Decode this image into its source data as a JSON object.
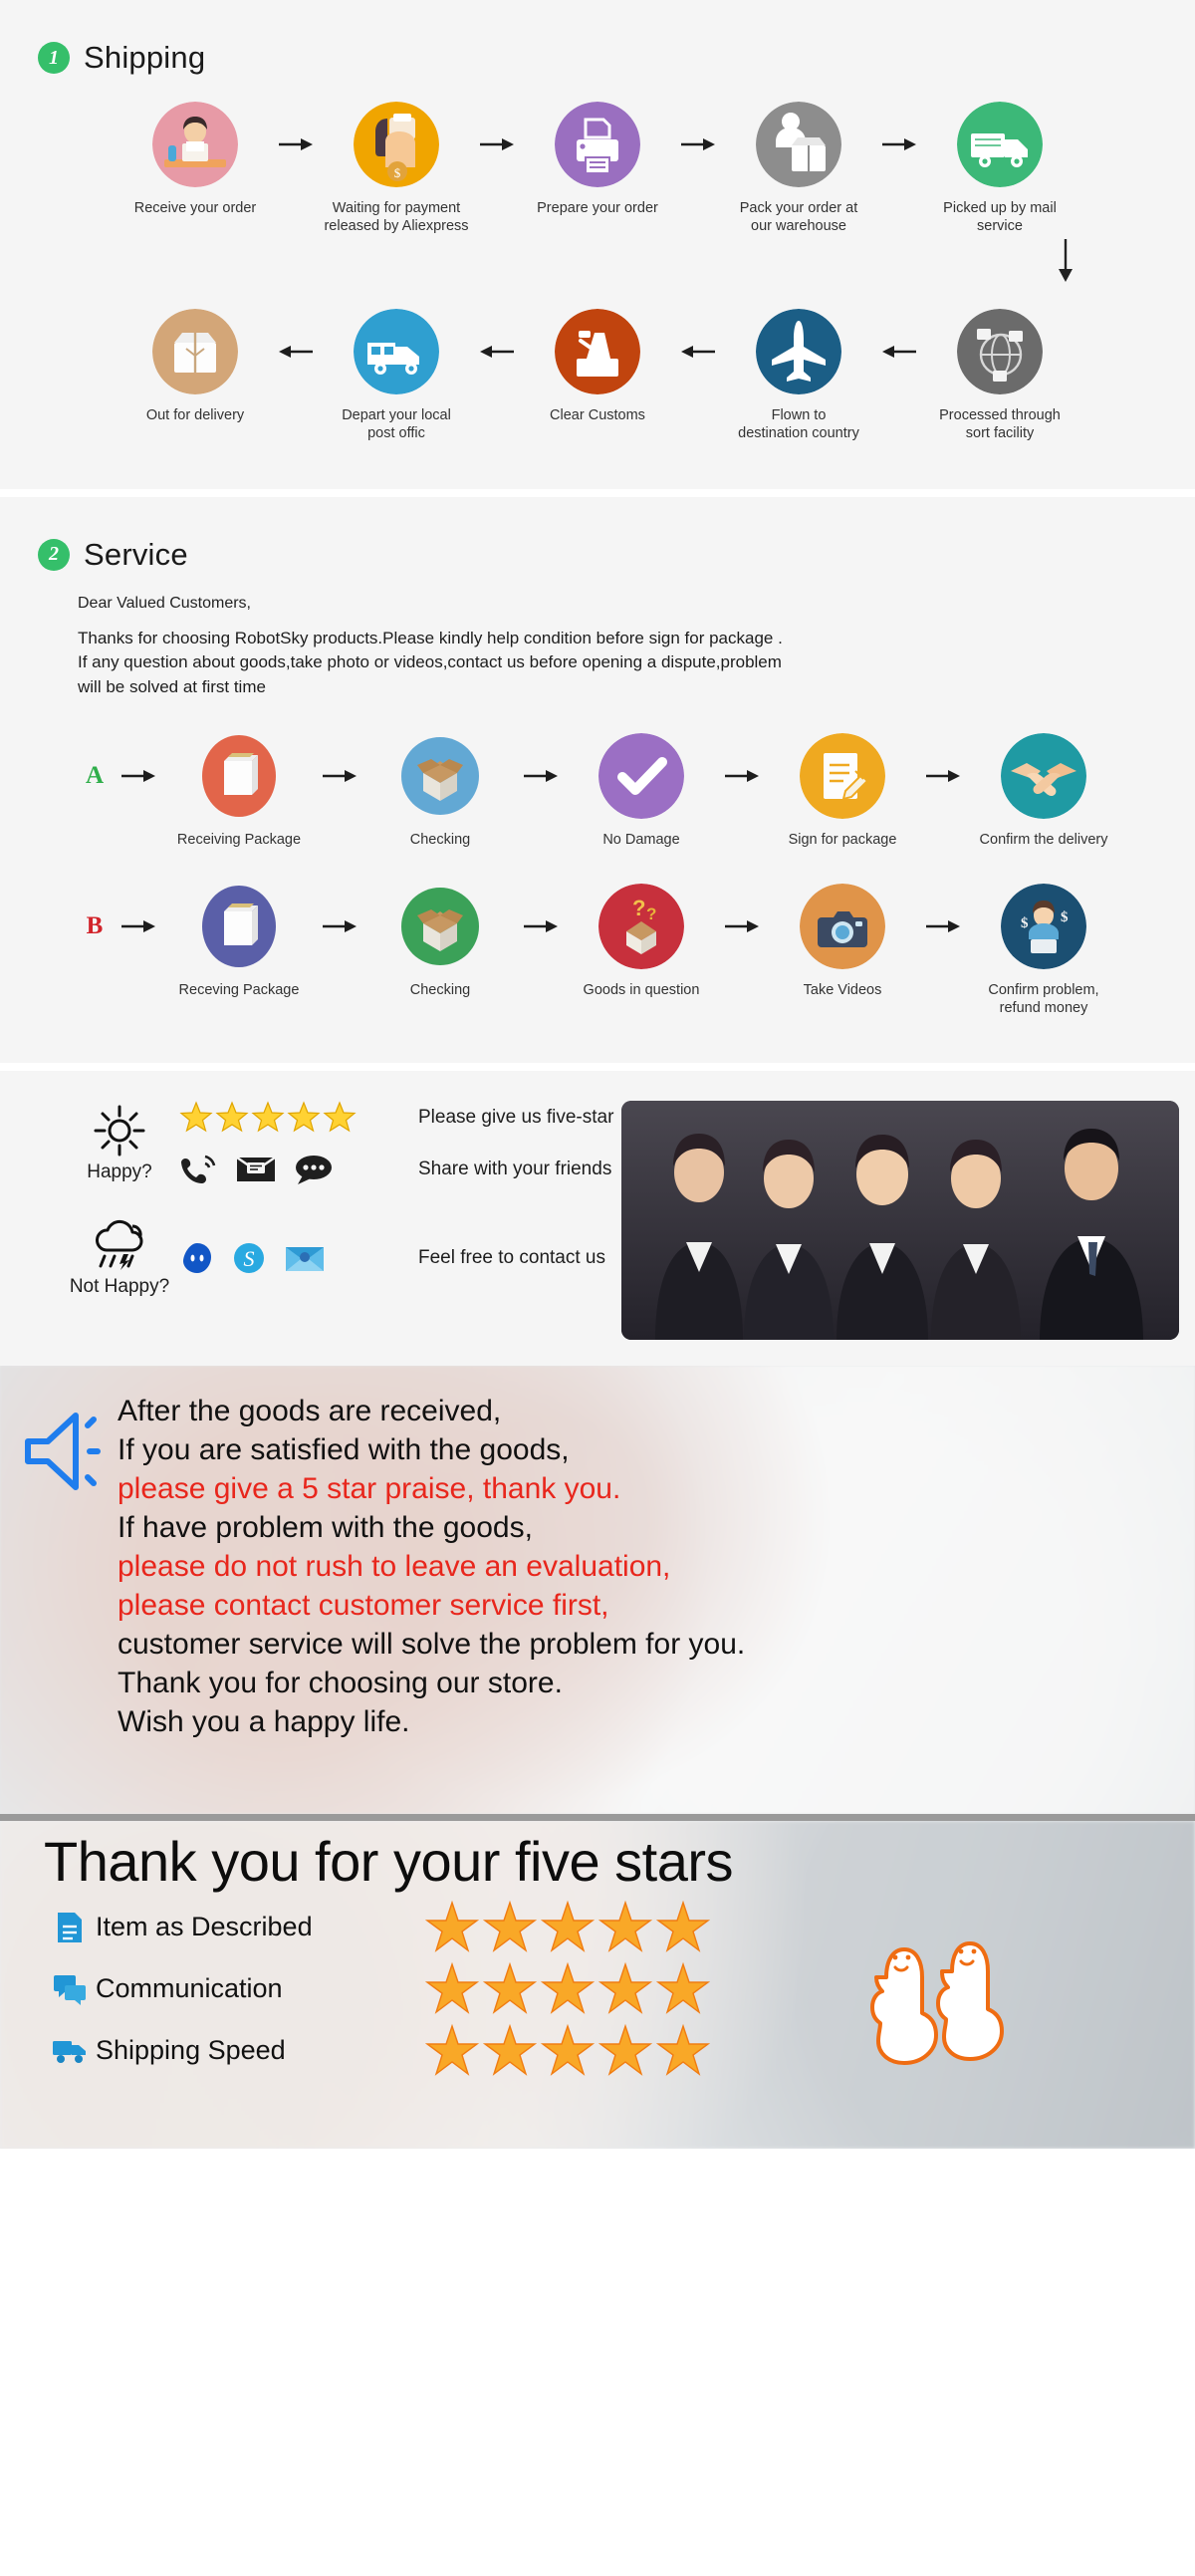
{
  "shipping": {
    "badge": "1",
    "title": "Shipping",
    "steps_row1": [
      {
        "label": "Receive your order",
        "icon": "person-at-desk-icon",
        "color": "#e79aa6"
      },
      {
        "label": "Waiting for payment\nreleased by Aliexpress",
        "icon": "payment-hand-coin-icon",
        "color": "#f0a500"
      },
      {
        "label": "Prepare your order",
        "icon": "printer-icon",
        "color": "#9a6fc0"
      },
      {
        "label": "Pack your order at\nour warehouse",
        "icon": "packing-hand-box-icon",
        "color": "#8d8d8d"
      },
      {
        "label": "Picked up by mail service",
        "icon": "delivery-truck-icon",
        "color": "#3cb878"
      }
    ],
    "steps_row2": [
      {
        "label": "Out for delivery",
        "icon": "parcel-box-icon",
        "color": "#d3a678"
      },
      {
        "label": "Depart your local\npost offic",
        "icon": "postal-van-icon",
        "color": "#2f9fd0"
      },
      {
        "label": "Clear  Customs",
        "icon": "customs-stamp-icon",
        "color": "#c1440e"
      },
      {
        "label": "Flown to\ndestination country",
        "icon": "airplane-icon",
        "color": "#1b5e86"
      },
      {
        "label": "Processed through\nsort facility",
        "icon": "globe-sorting-icon",
        "color": "#6b6b6b"
      }
    ]
  },
  "service": {
    "badge": "2",
    "title": "Service",
    "greeting": "Dear Valued Customers,",
    "body_line1": "Thanks for choosing RobotSky products.Please kindly help condition before sign for package .",
    "body_line2": "If any question about goods,take photo or videos,contact us before opening a dispute,problem",
    "body_line3": "will be solved at first time",
    "row_a_tag": "A",
    "row_b_tag": "B",
    "row_a": [
      {
        "label": "Receiving Package",
        "icon": "white-box-icon",
        "color": "#e2654a"
      },
      {
        "label": "Checking",
        "icon": "open-carton-icon",
        "color": "#62a8d4"
      },
      {
        "label": "No Damage",
        "icon": "checkmark-icon",
        "color": "#9b6fc4"
      },
      {
        "label": "Sign for package",
        "icon": "sign-document-icon",
        "color": "#efa920"
      },
      {
        "label": "Confirm the delivery",
        "icon": "handshake-icon",
        "color": "#1f9aa3"
      }
    ],
    "row_b": [
      {
        "label": "Receving Package",
        "icon": "white-box-icon",
        "color": "#5a5fa8"
      },
      {
        "label": "Checking",
        "icon": "open-carton-icon",
        "color": "#3ba158"
      },
      {
        "label": "Goods in question",
        "icon": "question-box-icon",
        "color": "#c7303c"
      },
      {
        "label": "Take Videos",
        "icon": "camera-icon",
        "color": "#e09449"
      },
      {
        "label": "Confirm problem,\nrefund money",
        "icon": "agent-money-icon",
        "color": "#1b4f72"
      }
    ]
  },
  "feedback": {
    "happy_label": "Happy?",
    "not_happy_label": "Not Happy?",
    "happy_icon": "sun-icon",
    "not_happy_icon": "rain-cloud-icon",
    "five_star_text": "Please give us five-star",
    "share_text": "Share with your friends",
    "contact_text": "Feel free to contact us",
    "star_count": 5,
    "share_icons": [
      "phone-ring-icon",
      "email-icon",
      "chat-bubble-icon"
    ],
    "contact_icons": [
      "trademanager-icon",
      "skype-icon",
      "message-envelope-icon"
    ],
    "photo_alt": "customer-service-team-photo"
  },
  "announcement": {
    "speaker_icon": "megaphone-icon",
    "lines": [
      {
        "text": "After the goods are received,",
        "color": "#111111"
      },
      {
        "text": "If you are satisfied with the goods,",
        "color": "#111111"
      },
      {
        "text": "please give a 5 star praise, thank you.",
        "color": "#e8261c"
      },
      {
        "text": "If have problem with the goods,",
        "color": "#111111"
      },
      {
        "text": "please do not rush to leave an evaluation,",
        "color": "#e8261c"
      },
      {
        "text": "please contact customer service first,",
        "color": "#e8261c"
      },
      {
        "text": "customer service will solve the problem for you.",
        "color": "#111111"
      },
      {
        "text": "Thank you for choosing our store.",
        "color": "#111111"
      },
      {
        "text": "Wish you a happy life.",
        "color": "#111111"
      }
    ]
  },
  "thanks": {
    "title": "Thank you for your five stars",
    "rows": [
      {
        "label": "Item as Described",
        "icon": "document-icon",
        "stars": 5
      },
      {
        "label": "Communication",
        "icon": "chat-icon",
        "stars": 5
      },
      {
        "label": "Shipping  Speed",
        "icon": "truck-icon",
        "stars": 5
      }
    ],
    "thumbs_icon": "two-thumbs-up-icon",
    "accent_blue": "#2196d6",
    "star_color": "#f7a020"
  }
}
